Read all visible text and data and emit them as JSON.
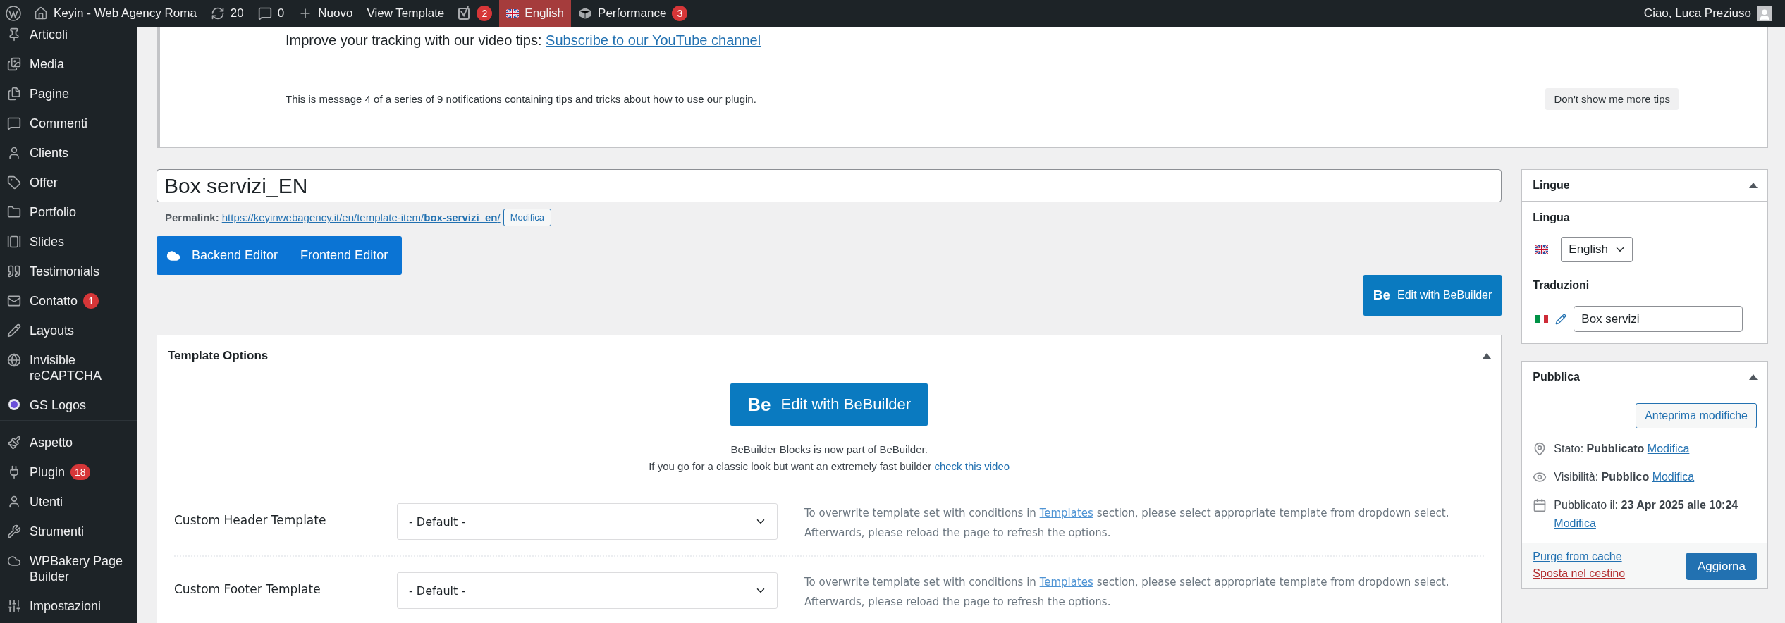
{
  "admin_bar": {
    "items": [
      {
        "kind": "site",
        "label": "Keyin - Web Agency Roma",
        "selected": false
      },
      {
        "kind": "updates",
        "label": "20",
        "selected": false
      },
      {
        "kind": "comments",
        "label": "0",
        "selected": false
      },
      {
        "kind": "new",
        "label": "Nuovo",
        "selected": false
      },
      {
        "kind": "plain",
        "label": "View Template",
        "selected": false
      },
      {
        "kind": "seo",
        "badge": "2",
        "selected": false
      },
      {
        "kind": "language",
        "label": "English",
        "selected": true
      },
      {
        "kind": "performance",
        "label": "Performance",
        "badge": "3",
        "selected": false
      }
    ],
    "account": "Ciao, Luca Preziuso"
  },
  "sidebar": {
    "items": [
      {
        "kind": "posts",
        "label": "Articoli"
      },
      {
        "kind": "media",
        "label": "Media"
      },
      {
        "kind": "pages",
        "label": "Pagine"
      },
      {
        "kind": "comments",
        "label": "Commenti"
      },
      {
        "kind": "person",
        "label": "Clients"
      },
      {
        "kind": "tag",
        "label": "Offer"
      },
      {
        "kind": "folder",
        "label": "Portfolio"
      },
      {
        "kind": "slides",
        "label": "Slides"
      },
      {
        "kind": "quote",
        "label": "Testimonials"
      },
      {
        "kind": "mail",
        "label": "Contatto",
        "badge": "1"
      },
      {
        "kind": "pencil",
        "label": "Layouts"
      },
      {
        "kind": "globe",
        "label": "Invisible reCAPTCHA"
      },
      {
        "kind": "dot",
        "label": "GS Logos"
      },
      {
        "kind": "brush",
        "label": "Aspetto",
        "gap": true
      },
      {
        "kind": "plug",
        "label": "Plugin",
        "badge": "18"
      },
      {
        "kind": "person",
        "label": "Utenti"
      },
      {
        "kind": "wrench",
        "label": "Strumenti"
      },
      {
        "kind": "cloud",
        "label": "WPBakery Page Builder"
      },
      {
        "kind": "sliders",
        "label": "Impostazioni"
      }
    ]
  },
  "notice": {
    "text": "Improve your tracking with our video tips: ",
    "link": "Subscribe to our YouTube channel",
    "message": "This is message 4 of a series of 9 notifications containing tips and tricks about how to use our plugin.",
    "dismiss_button": "Don't show me more tips"
  },
  "title": "Box servizi_EN",
  "permalink": {
    "label": "Permalink:",
    "url": "https://keyinwebagency.it/en/template-item/**box-servizi_en**/",
    "edit_button": "Modifica"
  },
  "editor_switch": [
    "Backend Editor",
    "Frontend Editor"
  ],
  "bebuilder_button": {
    "logo": "Be",
    "label": "Edit with BeBuilder"
  },
  "template_options": {
    "title": "Template Options",
    "bebuilder_button": {
      "logo": "Be",
      "label": "Edit with BeBuilder"
    },
    "info": "BeBuilder Blocks is now part of BeBuilder.",
    "info_text": "If you go for a classic look but want an extremely fast builder ",
    "info_link": "check this video",
    "rows": [
      {
        "label": "Custom Header Template",
        "value": "- Default -",
        "text_before": "To overwrite template set with conditions in ",
        "link": "Templates",
        "text_after": " section, please select appropriate template from dropdown select. Afterwards, please reload the page to refresh the options."
      },
      {
        "label": "Custom Footer Template",
        "value": "- Default -",
        "text_before": "To overwrite template set with conditions in ",
        "link": "Templates",
        "text_after": " section, please select appropriate template from dropdown select. Afterwards, please reload the page to refresh the options."
      }
    ]
  },
  "languages": {
    "title": "Lingue",
    "language_label": "Lingua",
    "language": "English",
    "translations_label": "Traduzioni",
    "translation": "Box servizi"
  },
  "publish": {
    "title": "Pubblica",
    "preview_button": "Anteprima modifiche",
    "rows": [
      {
        "kind": "status",
        "label": "Stato: ",
        "value": "Pubblicato",
        "link": "Modifica"
      },
      {
        "kind": "visibility",
        "label": "Visibilità: ",
        "value": "Pubblico",
        "link": "Modifica"
      },
      {
        "kind": "date",
        "label": "Pubblicato il: ",
        "value": "23 Apr 2025 alle 10:24",
        "link": "Modifica"
      }
    ],
    "purge_link": "Purge from cache",
    "trash_link": "Sposta nel cestino",
    "update_button": "Aggiorna"
  }
}
